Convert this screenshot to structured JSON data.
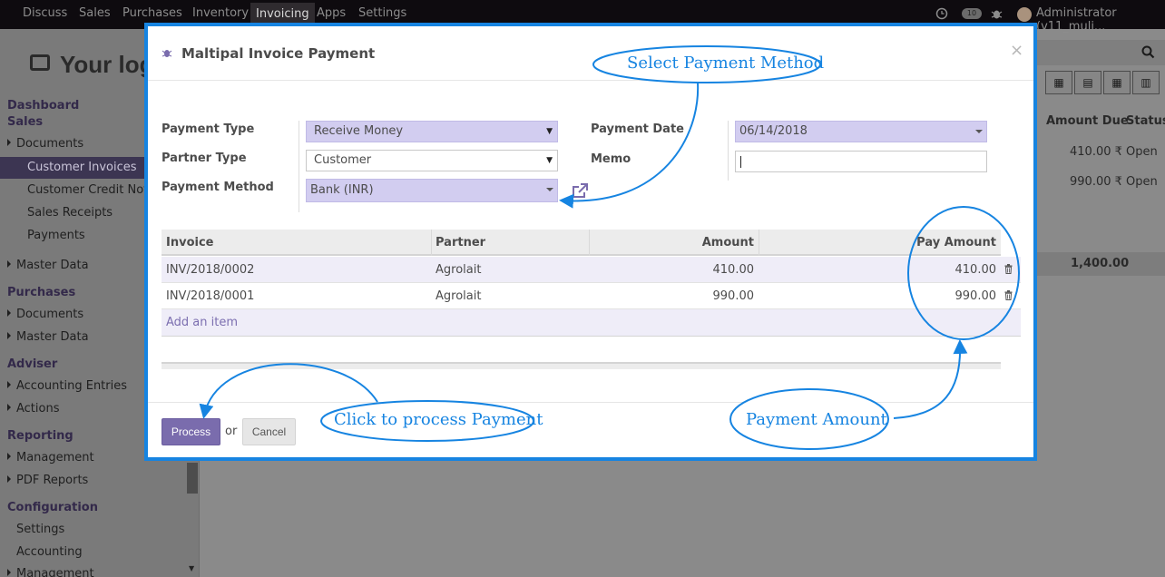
{
  "navbar": {
    "items": [
      "Discuss",
      "Sales",
      "Purchases",
      "Inventory",
      "Invoicing",
      "Apps",
      "Settings"
    ],
    "active_index": 4,
    "notification_count": "10",
    "user": "Administrator (v11_muli..."
  },
  "background": {
    "logo_text": "Your log",
    "sidebar": {
      "dashboard": "Dashboard",
      "sales": "Sales",
      "documents": "Documents",
      "customer_invoices": "Customer Invoices",
      "customer_credit_notes": "Customer Credit Notes",
      "sales_receipts": "Sales Receipts",
      "payments": "Payments",
      "master_data": "Master Data",
      "purchases": "Purchases",
      "purchases_documents": "Documents",
      "purchases_master_data": "Master Data",
      "adviser": "Adviser",
      "accounting_entries": "Accounting Entries",
      "actions": "Actions",
      "reporting": "Reporting",
      "management": "Management",
      "pdf_reports": "PDF Reports",
      "configuration": "Configuration",
      "settings": "Settings",
      "accounting": "Accounting",
      "management_2": "Management"
    },
    "list": {
      "col_amount_due": "Amount Due",
      "col_status": "Status",
      "rows": [
        {
          "amount_due": "410.00 ₹",
          "status": "Open"
        },
        {
          "amount_due": "990.00 ₹",
          "status": "Open"
        }
      ],
      "total": "1,400.00"
    }
  },
  "modal": {
    "title": "Maltipal Invoice Payment",
    "close_label": "×",
    "form": {
      "payment_type_label": "Payment Type",
      "payment_type_value": "Receive Money",
      "partner_type_label": "Partner Type",
      "partner_type_value": "Customer",
      "payment_method_label": "Payment Method",
      "payment_method_value": "Bank (INR)",
      "payment_date_label": "Payment Date",
      "payment_date_value": "06/14/2018",
      "memo_label": "Memo",
      "memo_value": ""
    },
    "table": {
      "headers": {
        "invoice": "Invoice",
        "partner": "Partner",
        "amount": "Amount",
        "pay_amount": "Pay Amount"
      },
      "rows": [
        {
          "invoice": "INV/2018/0002",
          "partner": "Agrolait",
          "amount": "410.00",
          "pay_amount": "410.00"
        },
        {
          "invoice": "INV/2018/0001",
          "partner": "Agrolait",
          "amount": "990.00",
          "pay_amount": "990.00"
        }
      ],
      "add_item": "Add an item"
    },
    "footer": {
      "process_label": "Process",
      "or_label": "or",
      "cancel_label": "Cancel"
    }
  },
  "annotations": {
    "select_payment_method": "Select Payment Method",
    "click_to_process": "Click to process Payment",
    "payment_amount": "Payment Amount",
    "color": "#1684e1"
  }
}
